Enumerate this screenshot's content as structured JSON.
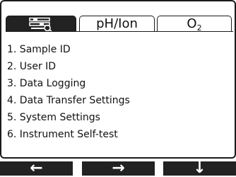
{
  "tabs": [
    {
      "icon": "settings-tools-icon",
      "active": true
    },
    {
      "label": "pH/Ion",
      "active": false
    },
    {
      "label_main": "O",
      "label_sub": "2",
      "active": false
    }
  ],
  "menu": {
    "items": [
      "1. Sample ID",
      "2. User ID",
      "3. Data Logging",
      "4. Data Transfer Settings",
      "5. System Settings",
      "6. Instrument Self-test"
    ]
  },
  "softkeys": {
    "left_glyph": "←",
    "right_glyph": "→",
    "down_glyph": "↓"
  },
  "colors": {
    "active_tab_bg": "#222222",
    "softkey_bg": "#222222",
    "border": "#1b1b1b"
  }
}
